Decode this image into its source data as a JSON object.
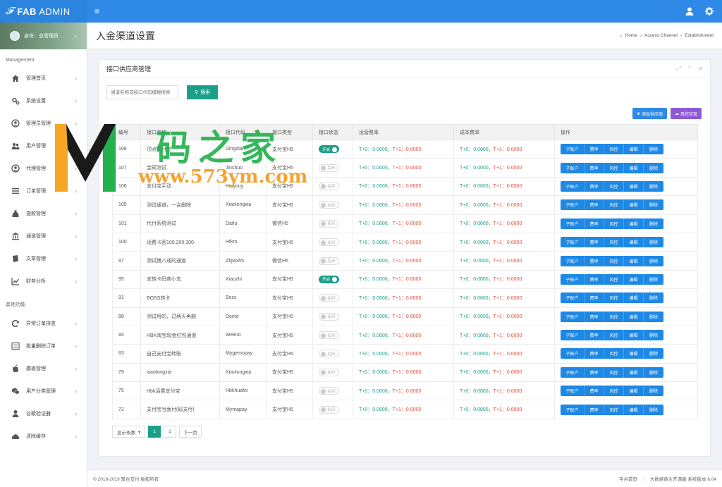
{
  "brand": {
    "logo": "𝓕",
    "title_bold": "FAB",
    "title_light": " ADMIN"
  },
  "profile": {
    "name": "身份：总管理员"
  },
  "sidebar": {
    "section1": "Management",
    "section2": "其他功能",
    "items": [
      {
        "label": "管理首页",
        "icon": "home-icon"
      },
      {
        "label": "系统设置",
        "icon": "gears-icon"
      },
      {
        "label": "管理员管理",
        "icon": "user-circle-icon"
      },
      {
        "label": "用户管理",
        "icon": "users-icon"
      },
      {
        "label": "代理管理",
        "icon": "user-circle-icon"
      },
      {
        "label": "订单管理",
        "icon": "list-icon"
      },
      {
        "label": "提款管理",
        "icon": "money-bag-icon"
      },
      {
        "label": "通道管理",
        "icon": "bank-icon"
      },
      {
        "label": "文章管理",
        "icon": "book-icon"
      },
      {
        "label": "财务分析",
        "icon": "line-chart-icon"
      }
    ],
    "other_items": [
      {
        "label": "异常订单排查",
        "icon": "refresh-icon"
      },
      {
        "label": "批量删除订单",
        "icon": "list-alt-icon"
      },
      {
        "label": "模板管理",
        "icon": "apple-icon"
      },
      {
        "label": "用户分类管理",
        "icon": "wechat-icon"
      },
      {
        "label": "谷歌验证器",
        "icon": "user-icon"
      },
      {
        "label": "清除缓存",
        "icon": "cloud-icon"
      }
    ]
  },
  "header": {
    "title": "入金渠道设置",
    "breadcrumb": [
      "Home",
      "Access Channel",
      "Establishment"
    ]
  },
  "card": {
    "title": "接口供应商管理",
    "search_placeholder": "通道名称或接口代码模糊搜索",
    "search_label": "搜索",
    "add_label": "添加供应商",
    "risk_label": "风控实现"
  },
  "table": {
    "columns": [
      "编号",
      "接口名称",
      "接口代码",
      "接口类型",
      "接口状态",
      "运营费率",
      "成本费率",
      "操作"
    ],
    "rate_t0": "T+0：0.0000，",
    "rate_t1": "T+1：0.0000",
    "ops": [
      "子账户",
      "费率",
      "风控",
      "编辑",
      "删除"
    ],
    "on_label": "开启",
    "off_label": "关闭",
    "rows": [
      {
        "id": "108",
        "name": "顶点支付宝",
        "code": "Dingdian",
        "type": "支付宝H5",
        "on": true
      },
      {
        "id": "107",
        "name": "金硕测试",
        "code": "Jinshuo",
        "type": "支付宝H5",
        "on": false
      },
      {
        "id": "106",
        "name": "支付宝手动",
        "code": "Huiyouy",
        "type": "支付宝H5",
        "on": false
      },
      {
        "id": "105",
        "name": "测试通道，一会删除",
        "code": "Xiaolongxia",
        "type": "支付宝H5",
        "on": false
      },
      {
        "id": "101",
        "name": "代付系统测试",
        "code": "Daifu",
        "type": "微信H5",
        "on": false
      },
      {
        "id": "100",
        "name": "话费卡密100,200,300",
        "code": "Hfkm",
        "type": "支付宝H5",
        "on": false
      },
      {
        "id": "97",
        "name": "测试猪八戒的通道",
        "code": "Zbjwxh5",
        "type": "微信H5",
        "on": false
      },
      {
        "id": "95",
        "name": "支转卡码商小志",
        "code": "Xiaozhi",
        "type": "支付宝H5",
        "on": true
      },
      {
        "id": "91",
        "name": "BOSS转卡",
        "code": "Boss",
        "type": "支付宝H5",
        "on": false
      },
      {
        "id": "88",
        "name": "测试用的，过两天再删",
        "code": "Demo",
        "type": "支付宝H5",
        "on": false
      },
      {
        "id": "84",
        "name": "HBK淘宝现金红包通道",
        "code": "Weimo",
        "type": "支付宝H5",
        "on": false
      },
      {
        "id": "83",
        "name": "自己支付宝转账",
        "code": "Mygemopay",
        "type": "支付宝H5",
        "on": false
      },
      {
        "id": "79",
        "name": "xiaolongxia",
        "code": "Xiaolongxia",
        "type": "支付宝H5",
        "on": false
      },
      {
        "id": "75",
        "name": "Hbk话费支付宝",
        "code": "Hbkhuafei",
        "type": "支付宝H5",
        "on": false
      },
      {
        "id": "72",
        "name": "支付宝当面付(码支付)",
        "code": "Mymapay",
        "type": "支付宝H5",
        "on": false
      }
    ]
  },
  "pager": {
    "size_label": "显示条数",
    "pages": [
      "1",
      "2"
    ],
    "next": "下一页"
  },
  "footer": {
    "copyright": "© 2018-2019 聚合支付 版权所有",
    "platform": "平台首页",
    "version": "大数据商业开源版 系统版本:6.04"
  },
  "watermark": {
    "main": "码之家",
    "sub": "www.573ym.com"
  },
  "colors": {
    "primary": "#2e8ae6",
    "teal": "#1aa089",
    "red": "#e24b3b",
    "purple": "#8c5ad8"
  }
}
